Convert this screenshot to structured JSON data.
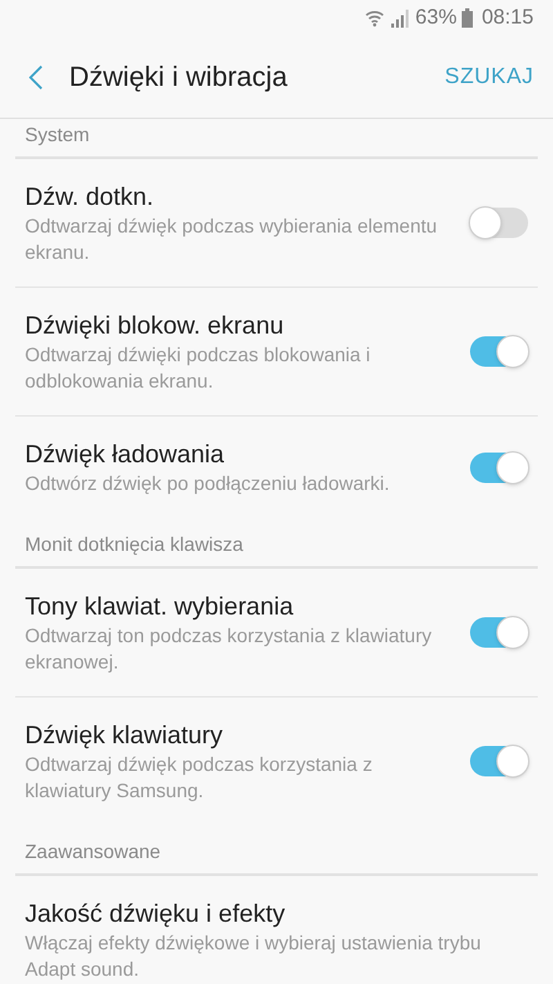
{
  "status_bar": {
    "battery": "63%",
    "time": "08:15"
  },
  "header": {
    "title": "Dźwięki i wibracja",
    "action": "SZUKAJ"
  },
  "sections": [
    {
      "title": "System",
      "items": [
        {
          "kind": "toggle",
          "title": "Dźw. dotkn.",
          "subtitle": "Odtwarzaj dźwięk podczas wybierania elementu ekranu.",
          "on": false
        },
        {
          "kind": "toggle",
          "title": "Dźwięki blokow. ekranu",
          "subtitle": "Odtwarzaj dźwięki podczas blokowania i odblokowania ekranu.",
          "on": true
        },
        {
          "kind": "toggle",
          "title": "Dźwięk ładowania",
          "subtitle": "Odtwórz dźwięk po podłączeniu ładowarki.",
          "on": true
        }
      ]
    },
    {
      "title": "Monit dotknięcia klawisza",
      "items": [
        {
          "kind": "toggle",
          "title": "Tony klawiat. wybierania",
          "subtitle": "Odtwarzaj ton podczas korzystania z klawiatury ekranowej.",
          "on": true
        },
        {
          "kind": "toggle",
          "title": "Dźwięk klawiatury",
          "subtitle": "Odtwarzaj dźwięk podczas korzystania z klawiatury Samsung.",
          "on": true
        }
      ]
    },
    {
      "title": "Zaawansowane",
      "items": [
        {
          "kind": "link",
          "title": "Jakość dźwięku i efekty",
          "subtitle": "Włączaj efekty dźwiękowe i wybieraj ustawienia trybu Adapt sound."
        }
      ]
    }
  ]
}
